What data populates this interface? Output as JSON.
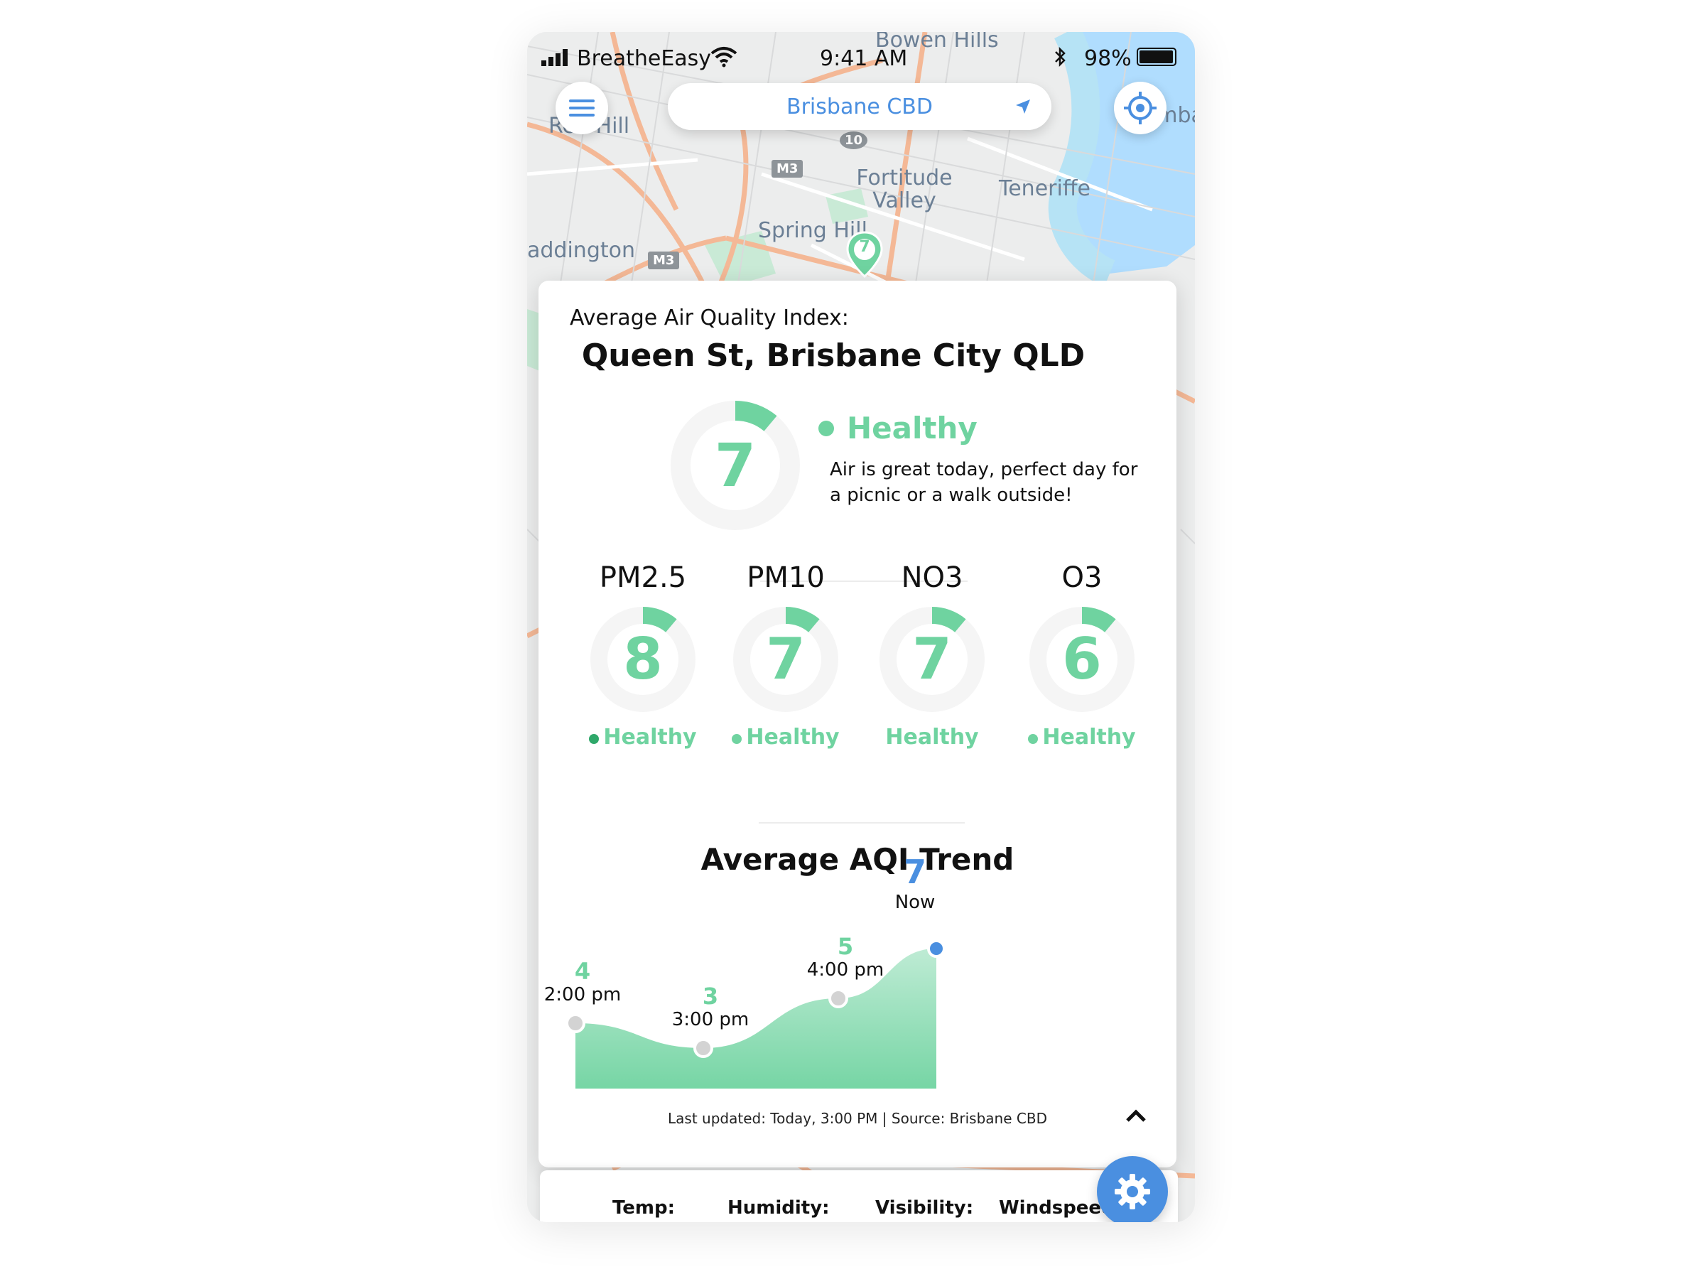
{
  "status_bar": {
    "carrier": "BreatheEasy",
    "time": "9:41 AM",
    "battery": "98%",
    "battery_level": 0.98
  },
  "header": {
    "location": "Brisbane CBD"
  },
  "map": {
    "labels": [
      "Bowen Hills",
      "Red Hill",
      "Fortitude Valley",
      "Teneriffe",
      "Spring Hill",
      "addington",
      "Bulimba"
    ],
    "shields": [
      "M3",
      "M3",
      "10"
    ],
    "marker_value": "7"
  },
  "aqi_card": {
    "heading": "Average Air Quality Index:",
    "address": "Queen St, Brisbane City QLD",
    "overall": {
      "value": "7",
      "status": "Healthy",
      "description_line1": "Air is great today, perfect day for",
      "description_line2": "a picnic or a walk outside!"
    },
    "pollutants": [
      {
        "name": "PM2.5",
        "value": "8",
        "status": "Healthy"
      },
      {
        "name": "PM10",
        "value": "7",
        "status": "Healthy"
      },
      {
        "name": "NO3",
        "value": "7",
        "status": "Healthy"
      },
      {
        "name": "O3",
        "value": "6",
        "status": "Healthy"
      }
    ],
    "trend_title": "Average AQI Trend",
    "footer": "Last updated: Today, 3:00 PM |  Source: Brisbane CBD"
  },
  "chart_data": {
    "type": "area",
    "title": "Average AQI Trend",
    "x": [
      "2:00 pm",
      "3:00 pm",
      "4:00 pm",
      "Now"
    ],
    "values": [
      4,
      3,
      5,
      7
    ],
    "ylim": [
      0,
      8
    ],
    "grid": false,
    "colors": {
      "fill": "#6fd3a0",
      "now": "#4a8fe0",
      "point": "#d3d3d3"
    }
  },
  "weather_card": {
    "labels": [
      "Temp:",
      "Humidity:",
      "Visibility:",
      "Windspeed"
    ]
  },
  "colors": {
    "healthy": "#6fd3a0",
    "accent": "#4a8fe0"
  }
}
